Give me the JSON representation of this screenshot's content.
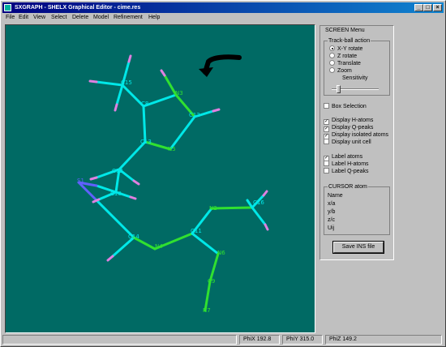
{
  "window": {
    "title": "SXGRAPH - SHELX Graphical Editor - cime.res"
  },
  "titlebar_buttons": {
    "minimize": "_",
    "maximize": "□",
    "close": "×"
  },
  "menu": [
    "File",
    "Edit",
    "View",
    "Select",
    "Delete",
    "Model",
    "Refinement",
    "Help"
  ],
  "panel": {
    "title": "SCREEN Menu",
    "trackball": {
      "title": "Track-ball action",
      "options": [
        "X-Y rotate",
        "Z rotate",
        "Translate",
        "Zoom"
      ],
      "selected": "X-Y rotate",
      "sensitivity_label": "Sensitivity",
      "sensitivity_level": 0.15
    },
    "checkboxes": [
      {
        "label": "Box Selection",
        "checked": false
      },
      {
        "label": "Display H-atoms",
        "checked": true
      },
      {
        "label": "Display Q-peaks",
        "checked": true
      },
      {
        "label": "Display isolated atoms",
        "checked": true
      },
      {
        "label": "Display unit cell",
        "checked": false
      },
      {
        "label": "Label atoms",
        "checked": true
      },
      {
        "label": "Label H-atoms",
        "checked": false
      },
      {
        "label": "Label Q-peaks",
        "checked": false
      }
    ],
    "cursor_atom": {
      "title": "CURSOR atom",
      "fields": [
        "Name",
        "x/a",
        "y/b",
        "z/c",
        "Uij"
      ]
    },
    "save_button": "Save INS file"
  },
  "status": {
    "phix": "PhiX  192.8",
    "phiy": "PhiY  315.0",
    "phiz": "PhiZ  149.2"
  },
  "colors": {
    "carbon": "#00e8e8",
    "nitrogen": "#30e030",
    "sulfur": "#6060ff",
    "hydrogen": "#e080e0",
    "background": "#006a64"
  },
  "molecule": {
    "labels": [
      "C15",
      "C8",
      "N3",
      "C12",
      "C13",
      "N5",
      "S1",
      "C12",
      "C10",
      "C14",
      "N4",
      "C11",
      "N2",
      "C16",
      "N6",
      "C9",
      "N7"
    ]
  }
}
